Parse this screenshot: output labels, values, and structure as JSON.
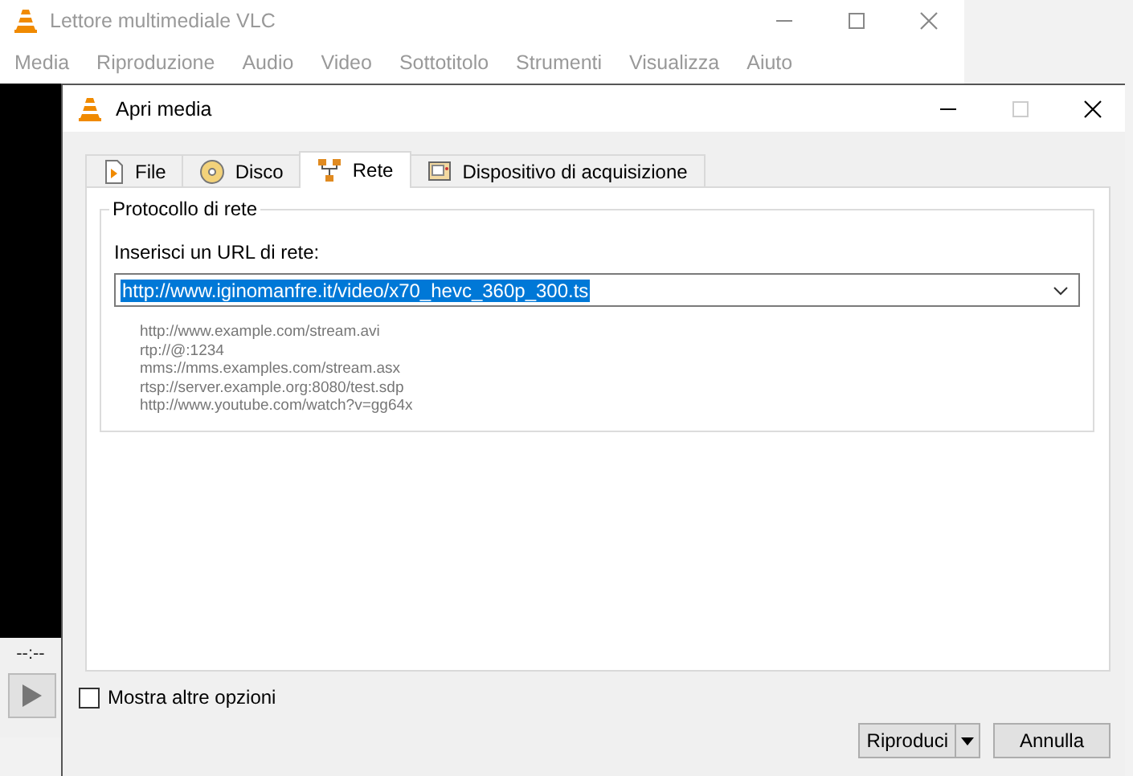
{
  "main_window": {
    "title": "Lettore multimediale VLC",
    "menu": [
      "Media",
      "Riproduzione",
      "Audio",
      "Video",
      "Sottotitolo",
      "Strumenti",
      "Visualizza",
      "Aiuto"
    ],
    "time": "--:--"
  },
  "dialog": {
    "title": "Apri media",
    "tabs": [
      {
        "label": "File",
        "kind": "file",
        "selected": false
      },
      {
        "label": "Disco",
        "kind": "disc",
        "selected": false
      },
      {
        "label": "Rete",
        "kind": "network",
        "selected": true
      },
      {
        "label": "Dispositivo di acquisizione",
        "kind": "capture",
        "selected": false
      }
    ],
    "group_title": "Protocollo di rete",
    "url_label": "Inserisci un URL di rete:",
    "url": {
      "value": "http://www.iginomanfre.it/video/x70_hevc_360p_300.ts",
      "selected": true
    },
    "examples": [
      "http://www.example.com/stream.avi",
      "rtp://@:1234",
      "mms://mms.examples.com/stream.asx",
      "rtsp://server.example.org:8080/test.sdp",
      "http://www.youtube.com/watch?v=gg64x"
    ],
    "show_more": {
      "label": "Mostra altre opzioni",
      "checked": false
    },
    "buttons": [
      {
        "label": "Riproduci",
        "kind": "split"
      },
      {
        "label": "Annulla",
        "kind": "plain"
      }
    ]
  }
}
